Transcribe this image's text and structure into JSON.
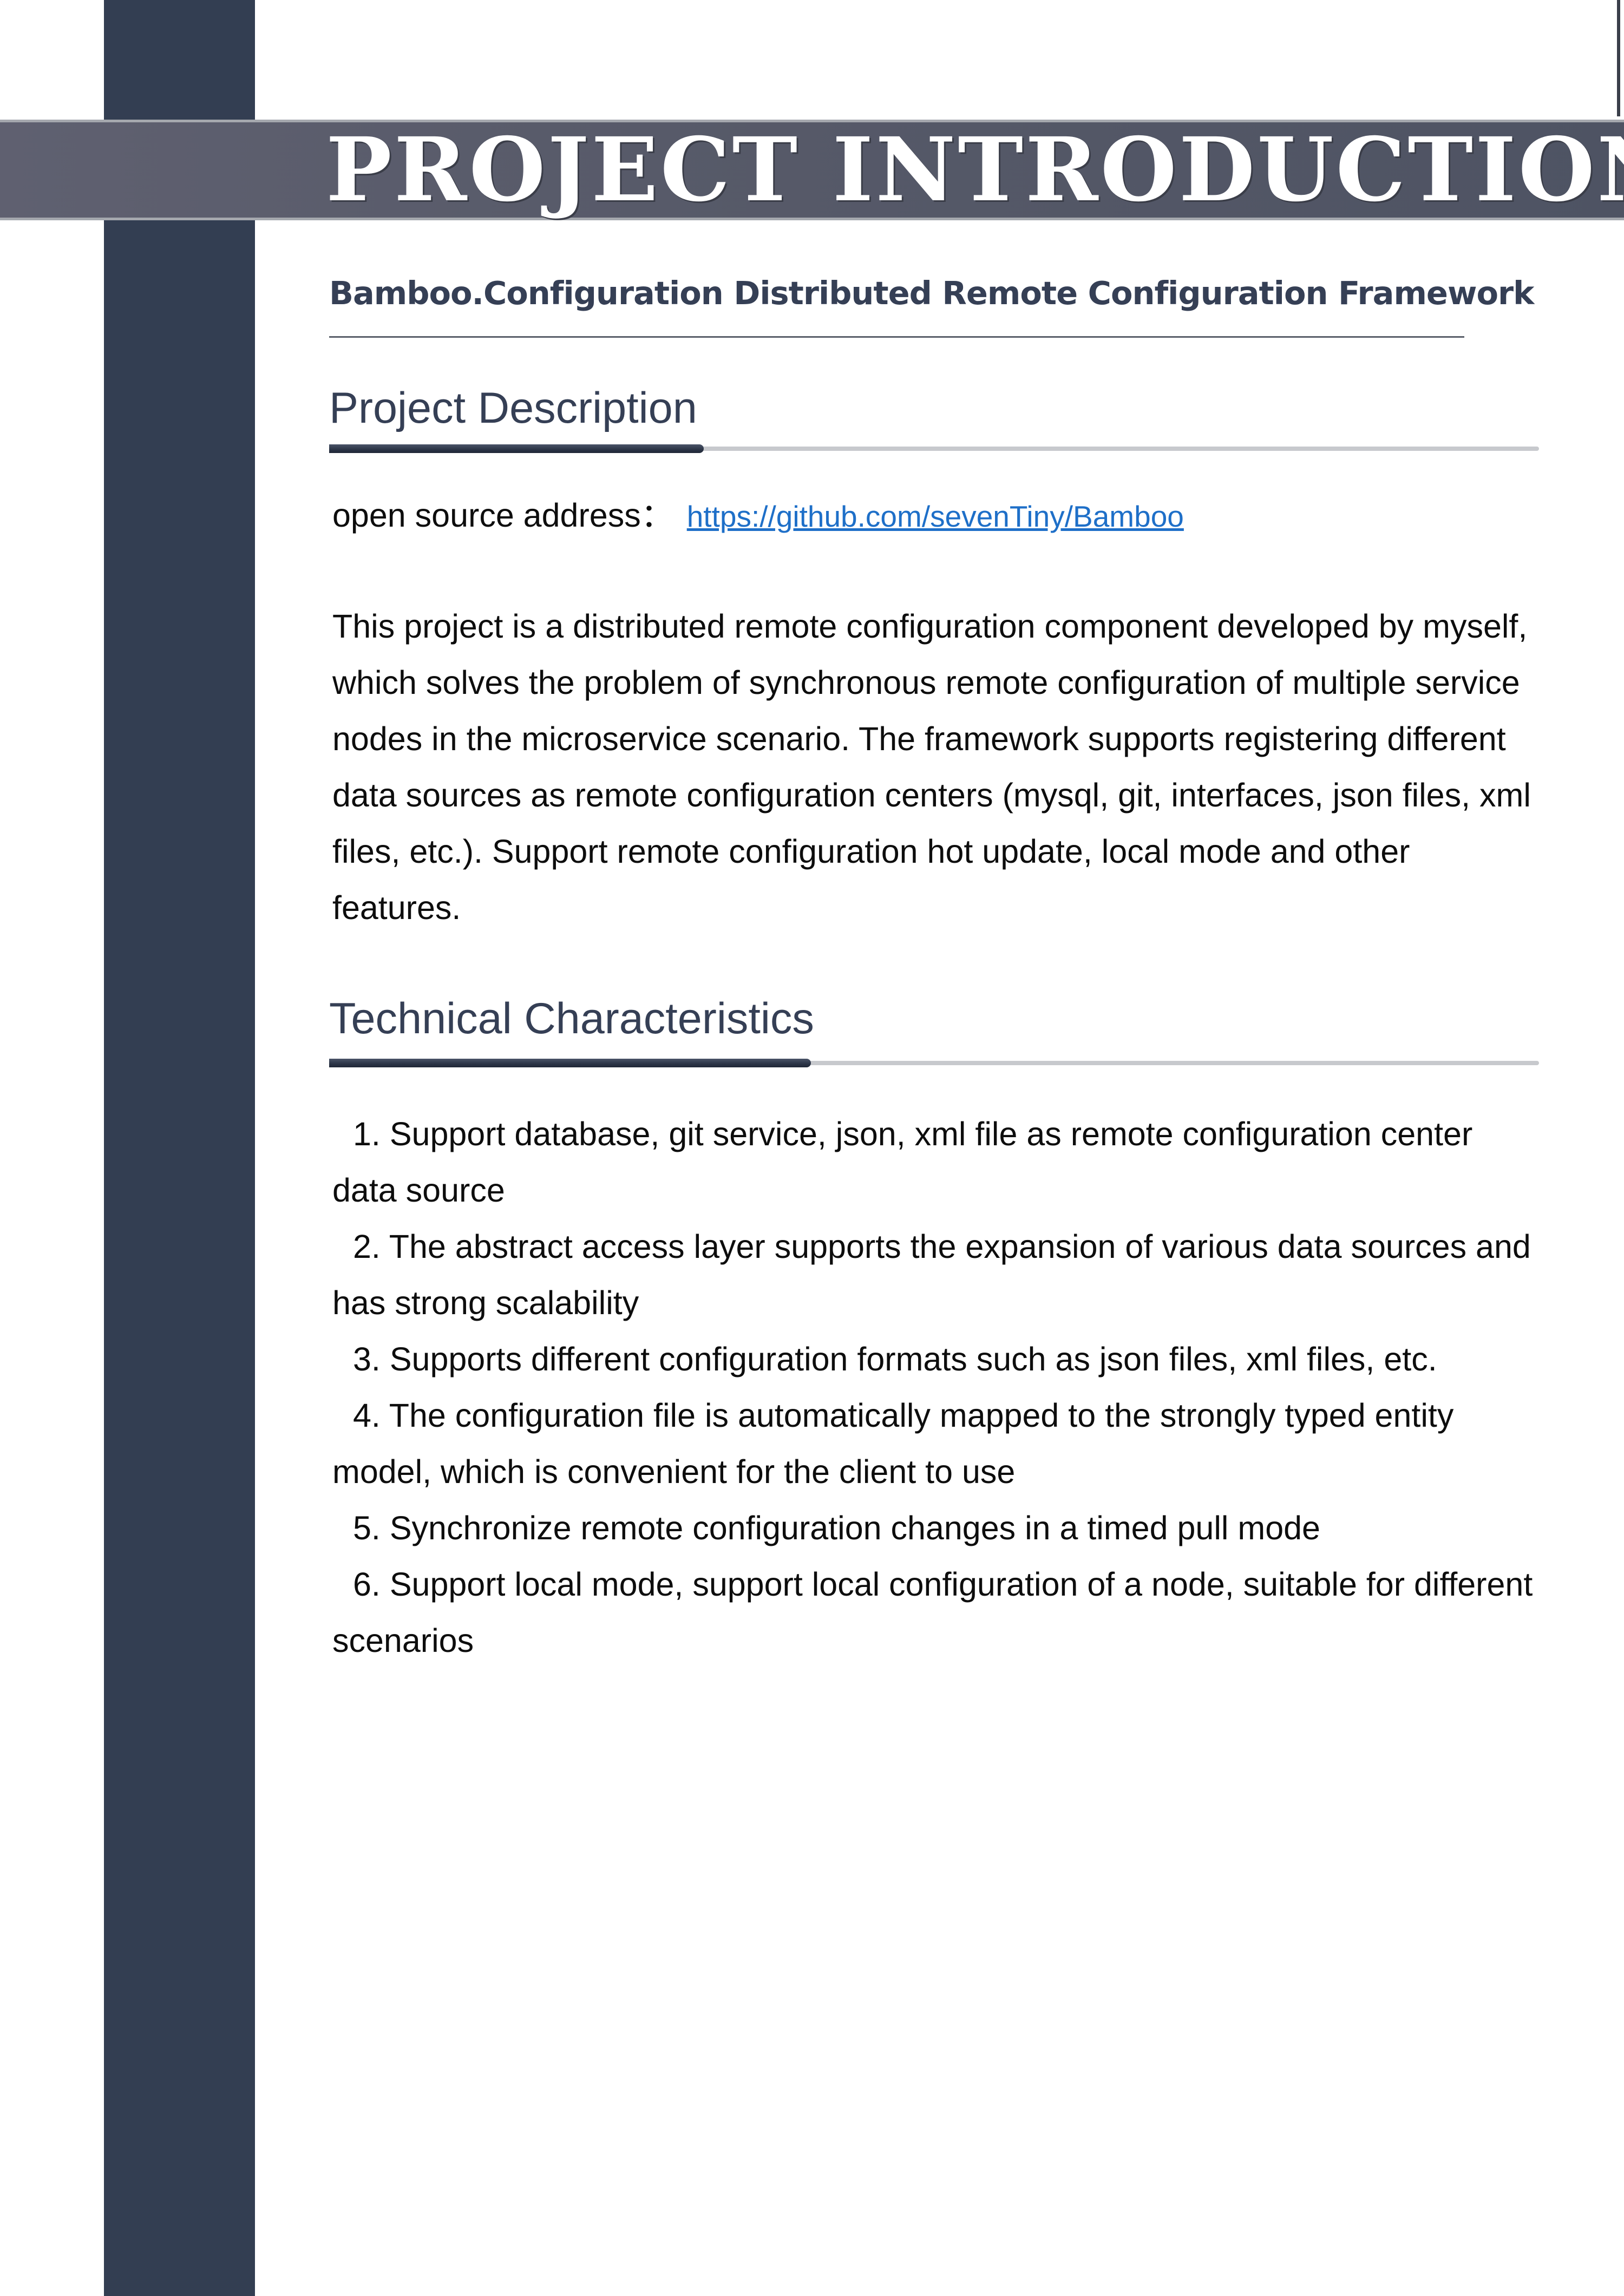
{
  "header": {
    "title": "PROJECT INTRODUCTION"
  },
  "subtitle": "Bamboo.Configuration Distributed Remote Configuration Framework",
  "description_section": {
    "heading": "Project Description",
    "oss_label": "open source address：",
    "oss_url": "https://github.com/sevenTiny/Bamboo",
    "paragraph": "This project is a distributed remote configuration component developed by myself, which solves the problem of synchronous remote configuration of multiple service nodes in the microservice scenario. The framework supports registering different data sources as remote configuration centers (mysql, git, interfaces, json files, xml files, etc.). Support remote configuration hot update, local mode and other features."
  },
  "tech_section": {
    "heading": "Technical Characteristics",
    "items": [
      {
        "num": "1.",
        "text": "Support database, git service, json, xml file as remote configuration center data source"
      },
      {
        "num": "2.",
        "text": "The abstract access layer supports the expansion of various data sources and has strong scalability"
      },
      {
        "num": "3.",
        "text": "Supports different configuration formats such as json files, xml files, etc."
      },
      {
        "num": "4.",
        "text": "The configuration file is automatically mapped to the strongly typed entity model, which is convenient for the client to use"
      },
      {
        "num": "5.",
        "text": "Synchronize remote configuration changes in a timed pull mode"
      },
      {
        "num": "6.",
        "text": "Support local mode, support local configuration of a node, suitable for different scenarios"
      }
    ]
  },
  "colors": {
    "sidebar": "#333e52",
    "banner": "#575a69",
    "heading": "#353f55",
    "link": "#1e6fc8"
  }
}
